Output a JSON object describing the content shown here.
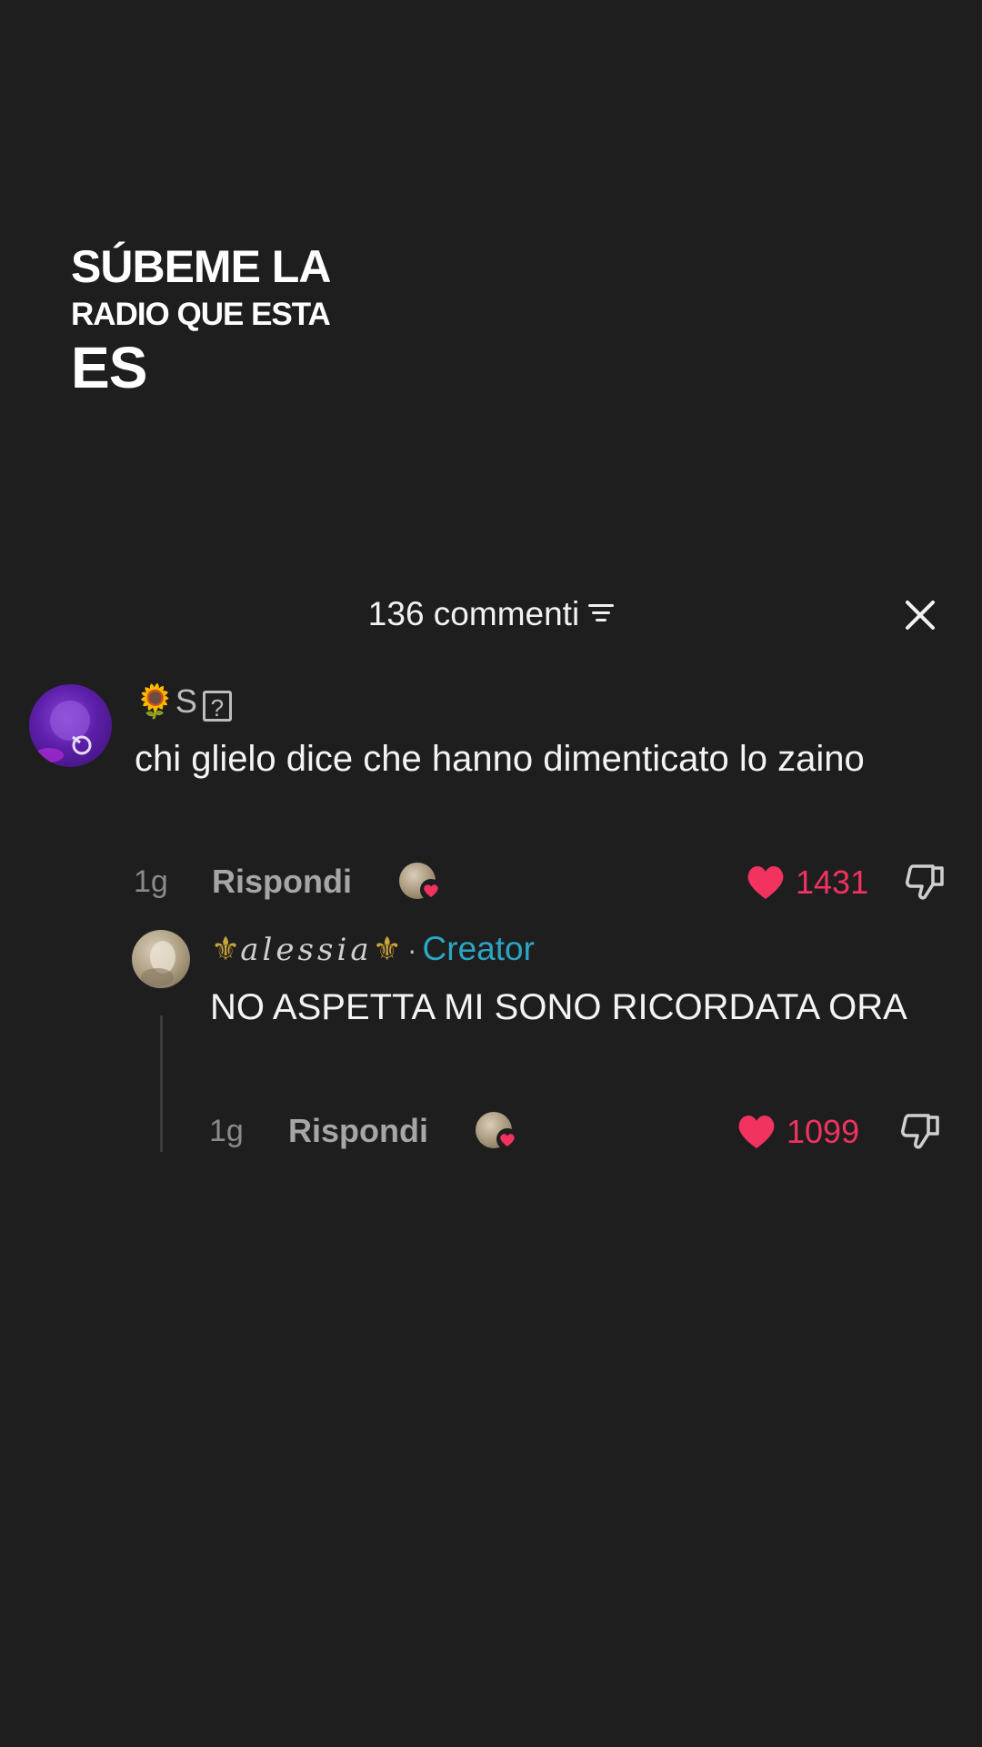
{
  "lyric": {
    "line1": "SÚBEME LA",
    "line2": "RADIO QUE ESTA",
    "line3": "ES"
  },
  "header": {
    "title": "136 commenti",
    "sort_icon": "sort-lines-icon",
    "close_icon": "close-icon"
  },
  "comments": [
    {
      "username": "🌻S",
      "username_suffix": "?",
      "text": "chi glielo dice che hanno dimenticato lo zaino",
      "time": "1g",
      "reply_label": "Rispondi",
      "likes": "1431"
    },
    {
      "username_prefix": "⚜",
      "username": "alessia",
      "username_suffix": "⚜",
      "separator": "·",
      "badge": "Creator",
      "text": "NO ASPETTA MI SONO RICORDATA ORA",
      "time": "1g",
      "reply_label": "Rispondi",
      "likes": "1099"
    }
  ],
  "colors": {
    "background": "#1e1e1f",
    "like": "#f2325f",
    "creator": "#2ba6c3"
  }
}
